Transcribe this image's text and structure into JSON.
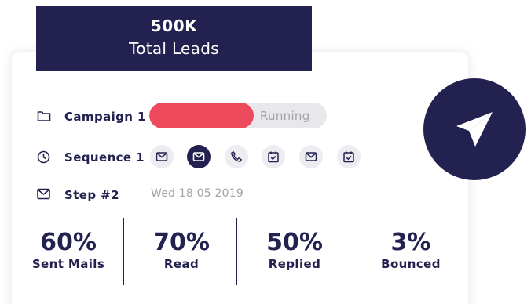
{
  "header": {
    "total_value": "500K",
    "total_label": "Total Leads"
  },
  "campaign": {
    "icon": "folder-icon",
    "label": "Campaign 1",
    "status": "Running",
    "progress_fraction": 0.59,
    "progress_color": "#ee4a5e"
  },
  "sequence": {
    "icon": "clock-icon",
    "label": "Sequence 1",
    "steps": [
      {
        "icon": "mail-icon",
        "active": false
      },
      {
        "icon": "mail-icon",
        "active": true
      },
      {
        "icon": "phone-icon",
        "active": false
      },
      {
        "icon": "calendar-check-icon",
        "active": false
      },
      {
        "icon": "mail-icon",
        "active": false
      },
      {
        "icon": "calendar-check-icon",
        "active": false
      }
    ]
  },
  "step": {
    "icon": "mail-icon",
    "label": "Step #2",
    "date": "Wed 18 05 2019"
  },
  "stats": [
    {
      "value": "60%",
      "label": "Sent Mails"
    },
    {
      "value": "70%",
      "label": "Read"
    },
    {
      "value": "50%",
      "label": "Replied"
    },
    {
      "value": "3%",
      "label": "Bounced"
    }
  ],
  "send_button": {
    "icon": "paper-plane-icon"
  },
  "colors": {
    "navy": "#23214f",
    "accent_red": "#ee4a5e",
    "muted_text": "#a3a3ab",
    "icon_bg": "#ececf1"
  }
}
